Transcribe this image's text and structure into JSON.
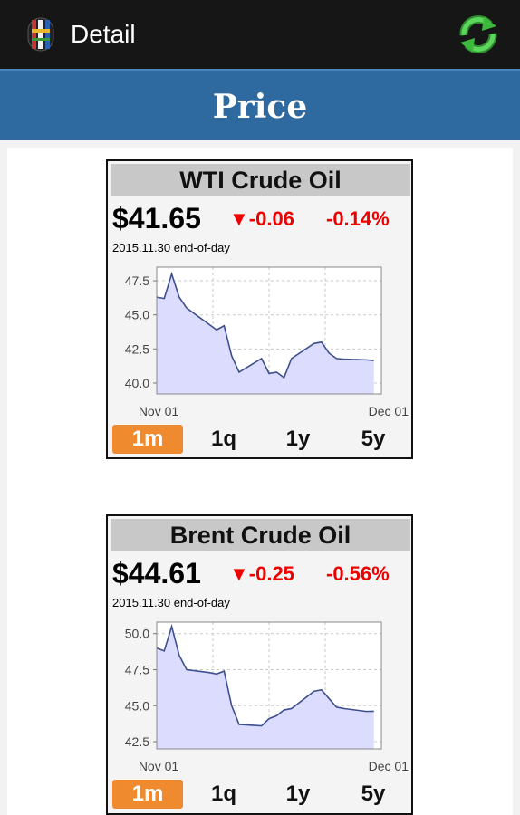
{
  "appbar": {
    "title": "Detail",
    "app_icon": "flag-app-icon",
    "refresh_icon": "refresh-icon"
  },
  "header": {
    "title": "Price"
  },
  "cards": [
    {
      "title": "WTI Crude Oil",
      "price": "$41.65",
      "change": "▼-0.06",
      "change_pct": "-0.14%",
      "date": "2015.11.30 end-of-day",
      "ranges": [
        "1m",
        "1q",
        "1y",
        "5y"
      ],
      "active_range": "1m",
      "chart_data": {
        "type": "area",
        "xlabels": [
          "Nov 01",
          "Dec 01"
        ],
        "ylim": [
          39.2,
          48.5
        ],
        "yticks": [
          40.0,
          42.5,
          45.0,
          47.5
        ],
        "ytick_labels": [
          "40.0",
          "42.5",
          "45.0",
          "47.5"
        ],
        "x": [
          0,
          1,
          2,
          3,
          4,
          7,
          8,
          9,
          10,
          11,
          14,
          15,
          16,
          17,
          18,
          21,
          22,
          23,
          24,
          25,
          28,
          29
        ],
        "values": [
          46.3,
          46.2,
          48.0,
          46.3,
          45.5,
          44.3,
          43.9,
          44.2,
          42.0,
          40.8,
          41.8,
          40.7,
          40.8,
          40.4,
          41.8,
          42.9,
          43.0,
          42.2,
          41.8,
          41.75,
          41.7,
          41.65
        ],
        "colors": {
          "line": "#3d4f8c",
          "fill": "#dcdcff",
          "grid": "#c8c8c8"
        }
      }
    },
    {
      "title": "Brent Crude Oil",
      "price": "$44.61",
      "change": "▼-0.25",
      "change_pct": "-0.56%",
      "date": "2015.11.30 end-of-day",
      "ranges": [
        "1m",
        "1q",
        "1y",
        "5y"
      ],
      "active_range": "1m",
      "chart_data": {
        "type": "area",
        "xlabels": [
          "Nov 01",
          "Dec 01"
        ],
        "ylim": [
          42.0,
          50.8
        ],
        "yticks": [
          42.5,
          45.0,
          47.5,
          50.0
        ],
        "ytick_labels": [
          "42.5",
          "45.0",
          "47.5",
          "50.0"
        ],
        "x": [
          0,
          1,
          2,
          3,
          4,
          7,
          8,
          9,
          10,
          11,
          14,
          15,
          16,
          17,
          18,
          21,
          22,
          23,
          24,
          25,
          28,
          29
        ],
        "values": [
          49.0,
          48.8,
          50.5,
          48.5,
          47.5,
          47.3,
          47.2,
          47.4,
          45.0,
          43.7,
          43.6,
          44.1,
          44.3,
          44.7,
          44.8,
          46.0,
          46.1,
          45.5,
          44.9,
          44.8,
          44.6,
          44.61
        ],
        "colors": {
          "line": "#3d4f8c",
          "fill": "#dcdcff",
          "grid": "#c8c8c8"
        }
      }
    }
  ]
}
